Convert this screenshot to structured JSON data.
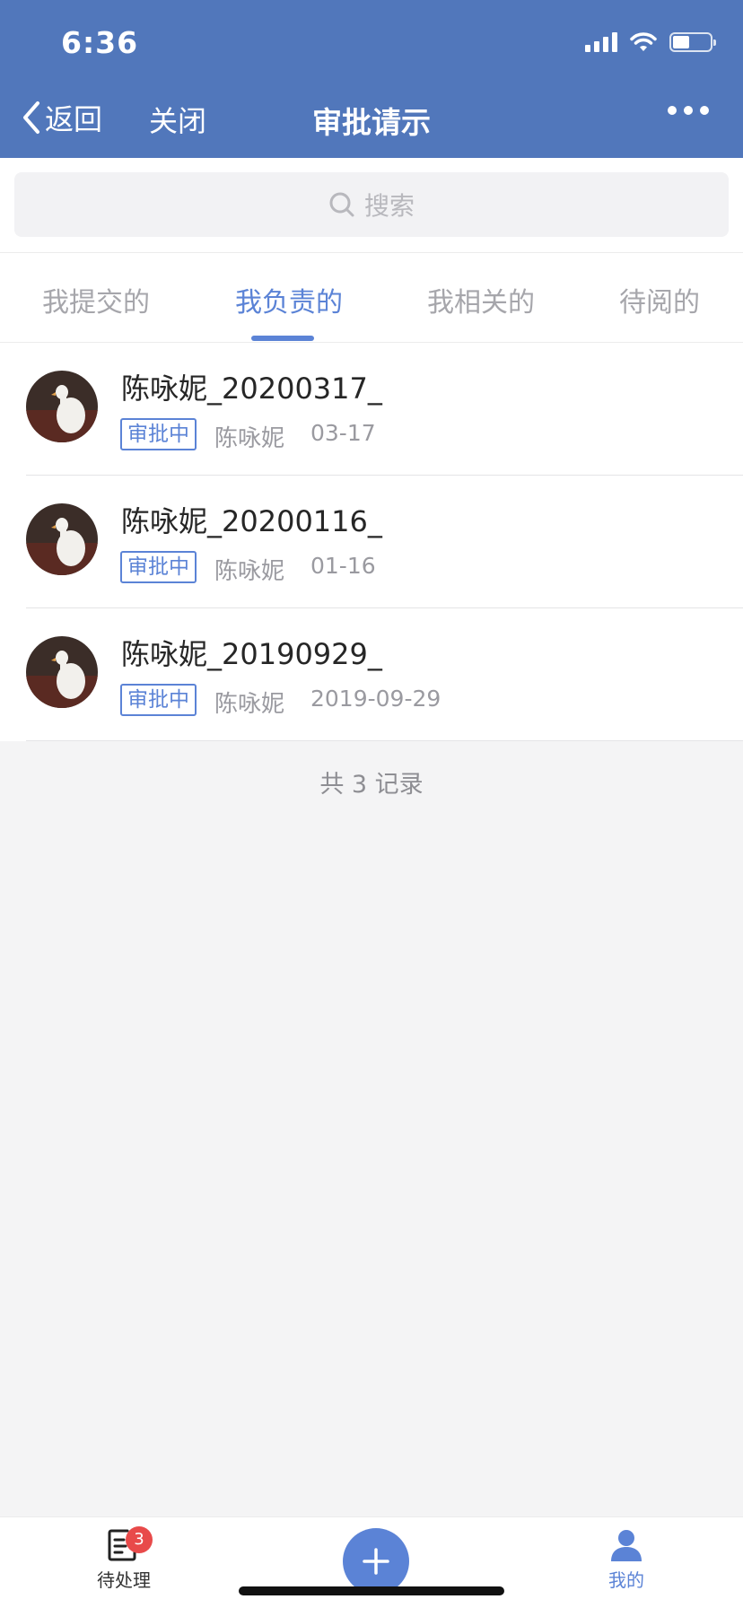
{
  "status_bar": {
    "time": "6:36"
  },
  "nav": {
    "back_label": "返回",
    "close_label": "关闭",
    "title": "审批请示"
  },
  "search": {
    "placeholder": "搜索"
  },
  "tabs": [
    {
      "label": "我提交的",
      "active": false
    },
    {
      "label": "我负责的",
      "active": true
    },
    {
      "label": "我相关的",
      "active": false
    },
    {
      "label": "待阅的",
      "active": false
    }
  ],
  "items": [
    {
      "title": "陈咏妮_20200317_",
      "status": "审批中",
      "author": "陈咏妮",
      "date": "03-17"
    },
    {
      "title": "陈咏妮_20200116_",
      "status": "审批中",
      "author": "陈咏妮",
      "date": "01-16"
    },
    {
      "title": "陈咏妮_20190929_",
      "status": "审批中",
      "author": "陈咏妮",
      "date": "2019-09-29"
    }
  ],
  "footer": {
    "record_count": "共 3 记录"
  },
  "tabbar": {
    "pending_label": "待处理",
    "pending_badge": "3",
    "mine_label": "我的"
  },
  "colors": {
    "header": "#5177bb",
    "accent": "#5b83d6",
    "badge": "#e84a4a"
  }
}
